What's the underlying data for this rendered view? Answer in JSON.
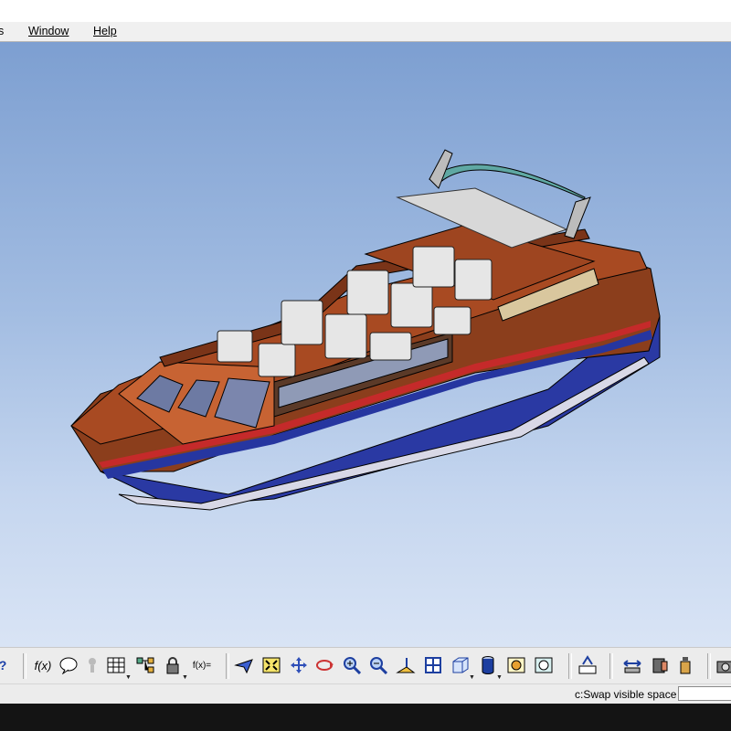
{
  "menubar": {
    "items": [
      {
        "label": "s",
        "key": "tools-menu-partial"
      },
      {
        "label": "Window",
        "key": "window-menu"
      },
      {
        "label": "Help",
        "key": "help-menu"
      }
    ]
  },
  "viewport": {
    "background_top": "#7d9fd1",
    "background_bottom": "#d9e4f5",
    "model": {
      "hull_brown": "#8b3e1c",
      "hull_blue": "#2a39a3",
      "seat_color": "#e6e6e6",
      "canopy_frame": "#5fa8a3"
    }
  },
  "toolbar": {
    "icons": [
      "help-icon",
      "formula-icon",
      "comment-icon",
      "knowledge-icon",
      "table-icon",
      "tree-icon",
      "lock-icon",
      "parameters-icon",
      "fly-mode-icon",
      "fit-all-icon",
      "pan-icon",
      "rotate-icon",
      "zoom-in-icon",
      "zoom-out-icon",
      "normal-view-icon",
      "multi-view-icon",
      "iso-view-icon",
      "shading-icon",
      "hide-show-icon",
      "swap-space-icon",
      "measure-icon",
      "distance-icon",
      "apply-material-icon",
      "bottle-icon",
      "camera-icon"
    ],
    "fx_label": "f(x)",
    "param_label": "f(x)="
  },
  "statusbar": {
    "message": "c:Swap visible space",
    "command_value": ""
  }
}
